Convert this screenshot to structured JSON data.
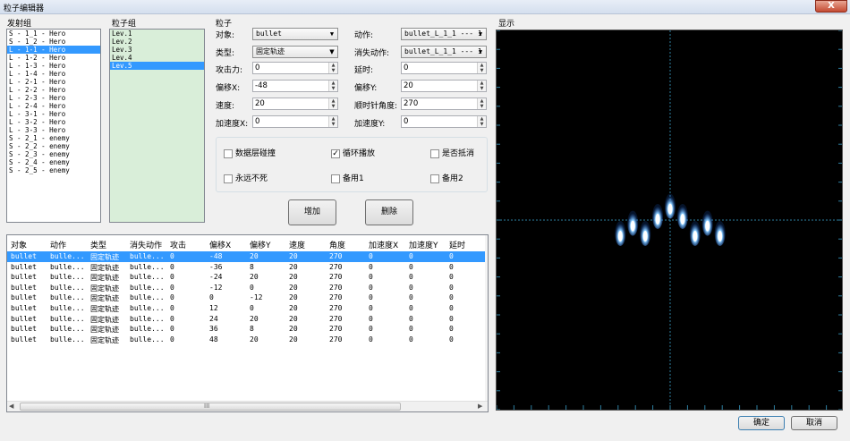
{
  "window": {
    "title": "粒子编辑器",
    "close": "X"
  },
  "launcher": {
    "title": "发射组",
    "items": [
      "S - 1_1 - Hero",
      "S - 1_2 - Hero",
      "L - 1-1 - Hero",
      "L - 1-2 - Hero",
      "L - 1-3 - Hero",
      "L - 1-4 - Hero",
      "L - 2-1 - Hero",
      "L - 2-2 - Hero",
      "L - 2-3 - Hero",
      "L - 2-4 - Hero",
      "L - 3-1 - Hero",
      "L - 3-2 - Hero",
      "L - 3-3 - Hero",
      "S - 2_1 - enemy",
      "S - 2_2 - enemy",
      "S - 2_3 - enemy",
      "S - 2_4 - enemy",
      "S - 2_5 - enemy"
    ],
    "selected_index": 2
  },
  "particle_group": {
    "title": "粒子组",
    "items": [
      "Lev.1",
      "Lev.2",
      "Lev.3",
      "Lev.4",
      "Lev.5"
    ],
    "selected_index": 4
  },
  "particle": {
    "title": "粒子",
    "target_label": "对象:",
    "target_value": "bullet",
    "action_label": "动作:",
    "action_value": "bullet_L_1_1 --- 1",
    "type_label": "类型:",
    "type_value": "固定轨迹",
    "vanish_label": "消失动作:",
    "vanish_value": "bullet_L_1_1 --- 1",
    "attack_label": "攻击力:",
    "attack_value": "0",
    "delay_label": "延时:",
    "delay_value": "0",
    "offx_label": "偏移X:",
    "offx_value": "-48",
    "offy_label": "偏移Y:",
    "offy_value": "20",
    "speed_label": "速度:",
    "speed_value": "20",
    "angle_label": "顺时针角度:",
    "angle_value": "270",
    "accx_label": "加速度X:",
    "accx_value": "0",
    "accy_label": "加速度Y:",
    "accy_value": "0"
  },
  "options": {
    "collide": {
      "label": "数据层碰撞",
      "checked": false
    },
    "loop": {
      "label": "循环播放",
      "checked": true
    },
    "offset": {
      "label": "是否抵消",
      "checked": false
    },
    "immortal": {
      "label": "永远不死",
      "checked": false
    },
    "spare1": {
      "label": "备用1",
      "checked": false
    },
    "spare2": {
      "label": "备用2",
      "checked": false
    },
    "check_mark": "✓"
  },
  "buttons": {
    "add": "增加",
    "delete": "删除",
    "ok": "确定",
    "cancel": "取消"
  },
  "table": {
    "headers": [
      "对象",
      "动作",
      "类型",
      "消失动作",
      "攻击",
      "偏移X",
      "偏移Y",
      "速度",
      "角度",
      "加速度X",
      "加速度Y",
      "延时"
    ],
    "rows": [
      [
        "bullet",
        "bulle...",
        "固定轨迹",
        "bulle...",
        "0",
        "-48",
        "20",
        "20",
        "270",
        "0",
        "0",
        "0"
      ],
      [
        "bullet",
        "bulle...",
        "固定轨迹",
        "bulle...",
        "0",
        "-36",
        "8",
        "20",
        "270",
        "0",
        "0",
        "0"
      ],
      [
        "bullet",
        "bulle...",
        "固定轨迹",
        "bulle...",
        "0",
        "-24",
        "20",
        "20",
        "270",
        "0",
        "0",
        "0"
      ],
      [
        "bullet",
        "bulle...",
        "固定轨迹",
        "bulle...",
        "0",
        "-12",
        "0",
        "20",
        "270",
        "0",
        "0",
        "0"
      ],
      [
        "bullet",
        "bulle...",
        "固定轨迹",
        "bulle...",
        "0",
        "0",
        "-12",
        "20",
        "270",
        "0",
        "0",
        "0"
      ],
      [
        "bullet",
        "bulle...",
        "固定轨迹",
        "bulle...",
        "0",
        "12",
        "0",
        "20",
        "270",
        "0",
        "0",
        "0"
      ],
      [
        "bullet",
        "bulle...",
        "固定轨迹",
        "bulle...",
        "0",
        "24",
        "20",
        "20",
        "270",
        "0",
        "0",
        "0"
      ],
      [
        "bullet",
        "bulle...",
        "固定轨迹",
        "bulle...",
        "0",
        "36",
        "8",
        "20",
        "270",
        "0",
        "0",
        "0"
      ],
      [
        "bullet",
        "bulle...",
        "固定轨迹",
        "bulle...",
        "0",
        "48",
        "20",
        "20",
        "270",
        "0",
        "0",
        "0"
      ]
    ],
    "selected_row": 0,
    "scroll_grip": "III",
    "scroll_left": "◀",
    "scroll_right": "▶"
  },
  "display": {
    "title": "显示",
    "background": "#000000",
    "grid_color": "#2e7fa0",
    "bullet_color": "#3fa9ff"
  }
}
